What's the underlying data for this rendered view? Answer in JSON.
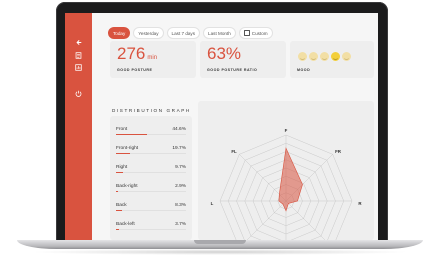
{
  "filters": [
    "Today",
    "Yesterday",
    "Last 7 days",
    "Last Month",
    "Custom"
  ],
  "active_filter": "Today",
  "stats": {
    "good_posture": {
      "value": "276",
      "unit": "min",
      "label": "GOOD POSTURE"
    },
    "ratio": {
      "value": "63%",
      "label": "GOOD POSTURE RATIO"
    },
    "mood": {
      "label": "MOOD",
      "options": 5,
      "selected_index": 3
    }
  },
  "section_title": "DISTRIBUTION GRAPH",
  "distribution": [
    {
      "label": "Front",
      "pct": "44.6%",
      "value": 44.6
    },
    {
      "label": "Front-right",
      "pct": "19.7%",
      "value": 19.7
    },
    {
      "label": "Right",
      "pct": "9.7%",
      "value": 9.7
    },
    {
      "label": "Back-right",
      "pct": "2.9%",
      "value": 2.9
    },
    {
      "label": "Back",
      "pct": "8.3%",
      "value": 8.3
    },
    {
      "label": "Back-left",
      "pct": "3.7%",
      "value": 3.7
    }
  ],
  "radar": {
    "axes": [
      "F",
      "FR",
      "R",
      "L",
      "FL"
    ],
    "rings": 8
  },
  "colors": {
    "accent": "#d9533f",
    "card": "#eeeeee"
  }
}
